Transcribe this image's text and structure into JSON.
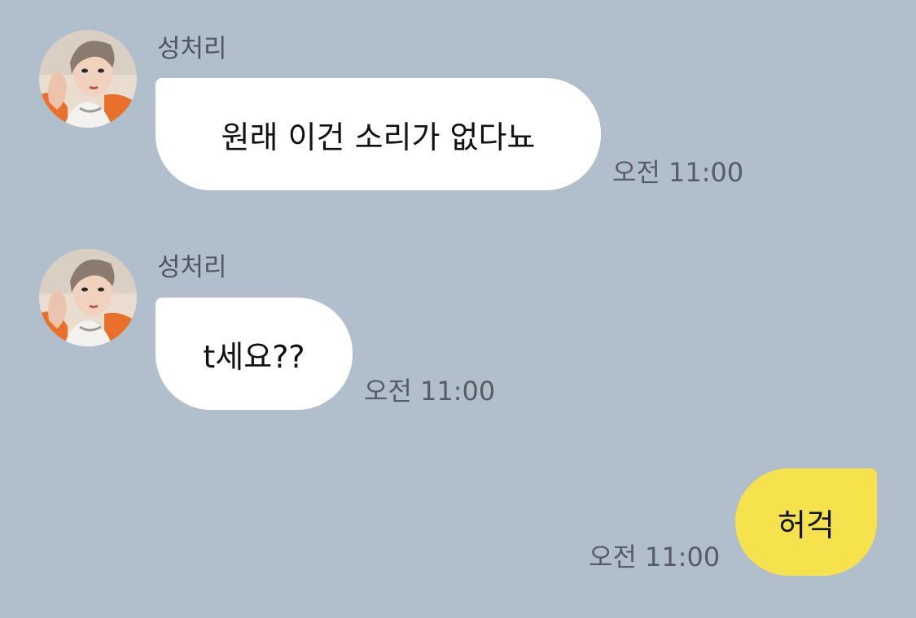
{
  "messages": [
    {
      "sender": "성처리",
      "text": "원래 이건 소리가 없다뇨",
      "time": "오전 11:00",
      "direction": "incoming"
    },
    {
      "sender": "성처리",
      "text": "t세요??",
      "time": "오전 11:00",
      "direction": "incoming"
    },
    {
      "text": "허걱",
      "time": "오전 11:00",
      "direction": "outgoing"
    }
  ],
  "colors": {
    "background": "#b1bfcd",
    "incoming_bubble": "#ffffff",
    "outgoing_bubble": "#f5e24c",
    "meta_text": "#565d67"
  }
}
